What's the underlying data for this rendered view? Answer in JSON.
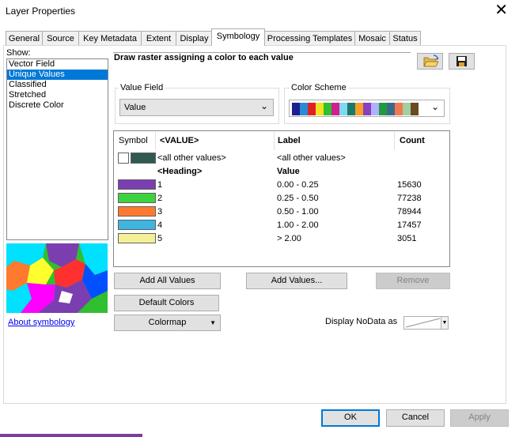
{
  "window": {
    "title": "Layer Properties",
    "close_icon": "close-icon"
  },
  "tabs": [
    {
      "label": "General"
    },
    {
      "label": "Source"
    },
    {
      "label": "Key Metadata"
    },
    {
      "label": "Extent"
    },
    {
      "label": "Display"
    },
    {
      "label": "Symbology",
      "active": true
    },
    {
      "label": "Processing Templates"
    },
    {
      "label": "Mosaic"
    },
    {
      "label": "Status"
    }
  ],
  "show": {
    "label": "Show:",
    "items": [
      {
        "label": "Vector Field"
      },
      {
        "label": "Unique Values",
        "selected": true
      },
      {
        "label": "Classified"
      },
      {
        "label": "Stretched"
      },
      {
        "label": "Discrete Color"
      }
    ]
  },
  "description": "Draw raster assigning a color to each value",
  "toolbar": {
    "open_icon": "folder-open-icon",
    "save_icon": "save-icon"
  },
  "value_field": {
    "group_label": "Value Field",
    "value": "Value"
  },
  "color_scheme": {
    "group_label": "Color Scheme",
    "colors": [
      "#1f1f8f",
      "#2b8ad6",
      "#e02020",
      "#f0e020",
      "#2fbf2f",
      "#d02090",
      "#7fd7f0",
      "#1a7a6a",
      "#f59f2a",
      "#8a3fbf",
      "#b0b0ff",
      "#209a40",
      "#3a6a8a",
      "#f07a50",
      "#a0d0a0",
      "#6a4a20"
    ]
  },
  "table": {
    "headers": {
      "symbol": "Symbol",
      "value": "<VALUE>",
      "label": "Label",
      "count": "Count"
    },
    "all_other": {
      "value": "<all other values>",
      "label": "<all other values>",
      "color": "#2e5a52"
    },
    "heading": {
      "value": "<Heading>",
      "label": "Value"
    },
    "rows": [
      {
        "value": "1",
        "label": "0.00 - 0.25",
        "count": "15630",
        "color": "#7a3eb1"
      },
      {
        "value": "2",
        "label": "0.25 - 0.50",
        "count": "77238",
        "color": "#3ed23e"
      },
      {
        "value": "3",
        "label": "0.50 - 1.00",
        "count": "78944",
        "color": "#ff7a2e"
      },
      {
        "value": "4",
        "label": "1.00 - 2.00",
        "count": "17457",
        "color": "#3eb4e0"
      },
      {
        "value": "5",
        "label": "> 2.00",
        "count": "3051",
        "color": "#f4f096"
      }
    ]
  },
  "buttons": {
    "add_all_values": "Add All Values",
    "add_values": "Add Values...",
    "remove": "Remove",
    "default_colors": "Default Colors",
    "colormap": "Colormap"
  },
  "nodata": {
    "label": "Display NoData as"
  },
  "about_link": "About symbology",
  "footer": {
    "ok": "OK",
    "cancel": "Cancel",
    "apply": "Apply"
  }
}
